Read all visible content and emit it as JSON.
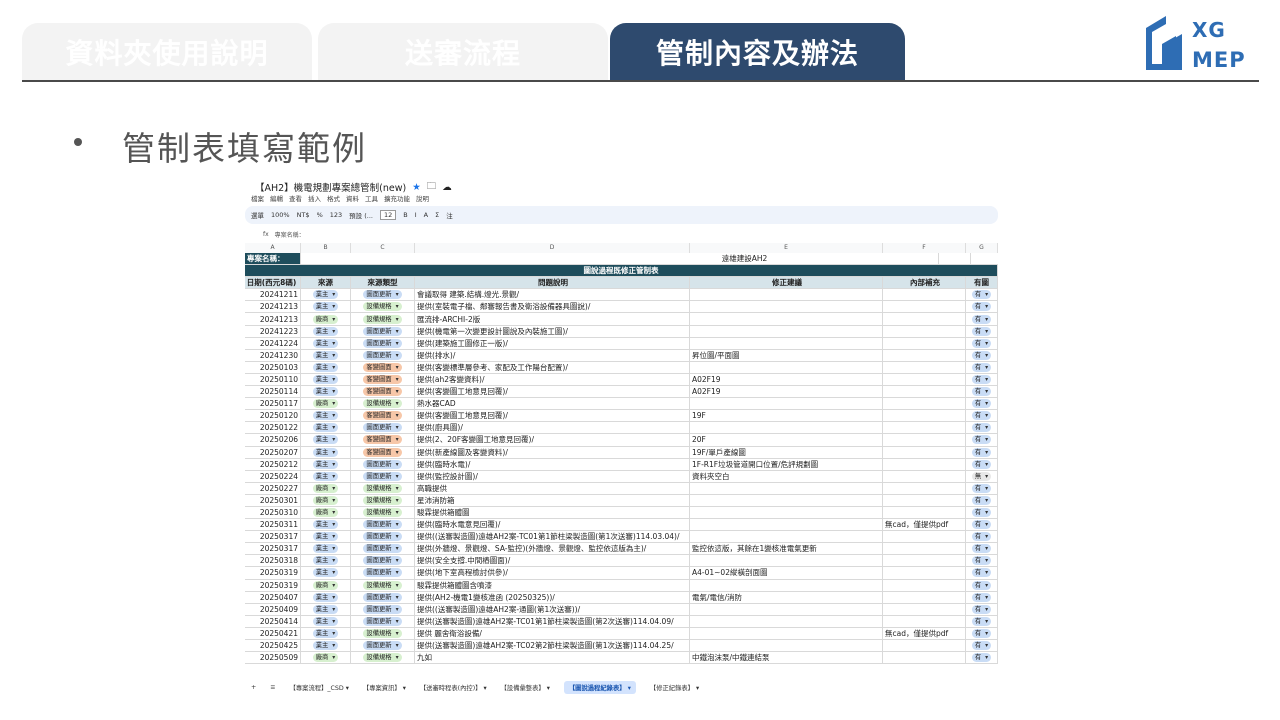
{
  "nav": {
    "tabs": [
      "資料夾使用說明",
      "送審流程",
      "管制內容及辦法"
    ],
    "active": 2
  },
  "logo": {
    "line1": "XG",
    "line2": "MEP"
  },
  "heading": "管制表填寫範例",
  "sheet": {
    "title": "【AH2】機電規劃專案總管制(new)",
    "menu": [
      "檔案",
      "編輯",
      "查看",
      "插入",
      "格式",
      "資料",
      "工具",
      "擴充功能",
      "說明"
    ],
    "toolbar": [
      "選單",
      "100%",
      "NT$",
      "%",
      "123",
      "預設 (...",
      "12",
      "B",
      "I",
      "A",
      "Σ",
      "注"
    ],
    "formula_label": "fx",
    "formula_value": "專案名稱：",
    "col_letters": [
      "A",
      "B",
      "C",
      "D",
      "E",
      "F",
      "G"
    ],
    "project_label": "專案名稱：",
    "project_name": "遠雄建設AH2",
    "table_title": "圖說過程既修正管制表",
    "headers": [
      "日期(西元8碼)",
      "來源",
      "來源類型",
      "問題說明",
      "修正建議",
      "內部補充",
      "有圖"
    ],
    "colors": {
      "業主": "#c9dcf5",
      "廠商": "#d7f0cf",
      "圖面更新": "#c9dcf5",
      "設備規格": "#d7f0cf",
      "客變圖面": "#f7c7a8",
      "有": "#c9dcf5",
      "無": "#e8e8e8"
    },
    "rows": [
      [
        "20241211",
        "業主",
        "圖面更新",
        "會議取得 建築.結構.燈光.景觀/",
        "",
        "",
        "有"
      ],
      [
        "20241213",
        "業主",
        "設備規格",
        "提供(室裝電子檔、鄰審報告書及衛浴設備器具圖說)/",
        "",
        "",
        "有"
      ],
      [
        "20241213",
        "廠商",
        "設備規格",
        "匯流排-ARCHI-2版",
        "",
        "",
        "有"
      ],
      [
        "20241223",
        "業主",
        "圖面更新",
        "提供(機電第一次變更設計圖說及內裝施工圖)/",
        "",
        "",
        "有"
      ],
      [
        "20241224",
        "業主",
        "圖面更新",
        "提供(建築施工圖修正一版)/",
        "",
        "",
        "有"
      ],
      [
        "20241230",
        "業主",
        "圖面更新",
        "提供(排水)/",
        "昇位圖/平面圖",
        "",
        "有"
      ],
      [
        "20250103",
        "業主",
        "客變圖面",
        "提供(客變標準層參考、家配及工作陽台配置)/",
        "",
        "",
        "有"
      ],
      [
        "20250110",
        "業主",
        "客變圖面",
        "提供(ah2客變資料)/",
        "A02F19",
        "",
        "有"
      ],
      [
        "20250114",
        "業主",
        "客變圖面",
        "提供(客變圖工地意見回覆)/",
        "A02F19",
        "",
        "有"
      ],
      [
        "20250117",
        "廠商",
        "設備規格",
        "熱水器CAD",
        "",
        "",
        "有"
      ],
      [
        "20250120",
        "業主",
        "客變圖面",
        "提供(客變圖工地意見回覆)/",
        "19F",
        "",
        "有"
      ],
      [
        "20250122",
        "業主",
        "圖面更新",
        "提供(廚具圖)/",
        "",
        "",
        "有"
      ],
      [
        "20250206",
        "業主",
        "客變圖面",
        "提供(2、20F客變圖工地意見回覆)/",
        "20F",
        "",
        "有"
      ],
      [
        "20250207",
        "業主",
        "客變圖面",
        "提供(新產線圖及客變資料)/",
        "19F/單戶產線圖",
        "",
        "有"
      ],
      [
        "20250212",
        "業主",
        "圖面更新",
        "提供(臨時水電)/",
        "1F-R1F垃圾管道開口位置/危評規劃圖",
        "",
        "有"
      ],
      [
        "20250224",
        "業主",
        "圖面更新",
        "提供(監控設計圖)/",
        "資料夾空白",
        "",
        "無"
      ],
      [
        "20250227",
        "廠商",
        "設備規格",
        "高職提供",
        "",
        "",
        "有"
      ],
      [
        "20250301",
        "廠商",
        "設備規格",
        "星沛消防箱",
        "",
        "",
        "有"
      ],
      [
        "20250310",
        "廠商",
        "設備規格",
        "駿霖提供箱體圖",
        "",
        "",
        "有"
      ],
      [
        "20250311",
        "業主",
        "圖面更新",
        "提供(臨時水電意見回覆)/",
        "",
        "無cad，僅提供pdf",
        "有"
      ],
      [
        "20250317",
        "業主",
        "圖面更新",
        "提供((送審製造圖)遠雄AH2案-TC01第1節柱梁製造圖(第1次送審)114.03.04)/",
        "",
        "",
        "有"
      ],
      [
        "20250317",
        "業主",
        "圖面更新",
        "提供(外牆燈、景觀燈、SA-監控)(外牆燈、景觀燈、監控依這版為主)/",
        "監控依這版，其餘在1變核准電氣更新",
        "",
        "有"
      ],
      [
        "20250318",
        "業主",
        "圖面更新",
        "提供(安全支撐.中間樁圖面)/",
        "",
        "",
        "有"
      ],
      [
        "20250319",
        "業主",
        "圖面更新",
        "提供(地下室高程檢討供參)/",
        "A4-01~02縱橫剖面圖",
        "",
        "有"
      ],
      [
        "20250319",
        "廠商",
        "設備規格",
        "駿霖提供箱體圖含噴漆",
        "",
        "",
        "有"
      ],
      [
        "20250407",
        "業主",
        "圖面更新",
        "提供(AH2-機電1變核准函 (20250325))/",
        "電氣/電信/消防",
        "",
        "有"
      ],
      [
        "20250409",
        "業主",
        "圖面更新",
        "提供((送審製造圖)遠雄AH2案-通圖(第1次送審))/",
        "",
        "",
        "有"
      ],
      [
        "20250414",
        "業主",
        "圖面更新",
        "提供(送審製造圖)遠雄AH2案-TC01第1節柱梁製造圖(第2次送審)114.04.09/",
        "",
        "",
        "有"
      ],
      [
        "20250421",
        "業主",
        "設備規格",
        "提供 麗舍衛浴設備/",
        "",
        "無cad，僅提供pdf",
        "有"
      ],
      [
        "20250425",
        "業主",
        "圖面更新",
        "提供(送審製造圖)遠雄AH2案-TC02第2節柱梁製造圖(第1次送審)114.04.25/",
        "",
        "",
        "有"
      ],
      [
        "20250509",
        "廠商",
        "設備規格",
        "九如",
        "中鐵泡沫泵/中鐵連結泵",
        "",
        "有"
      ]
    ],
    "sheet_tabs": [
      "【專案流程】_CSD",
      "【專案資訊】",
      "【送審時程表(內控)】",
      "【設備彙整表】",
      "【圖說過程紀錄表】",
      "【修正紀錄表】"
    ],
    "active_sheet": 4
  }
}
